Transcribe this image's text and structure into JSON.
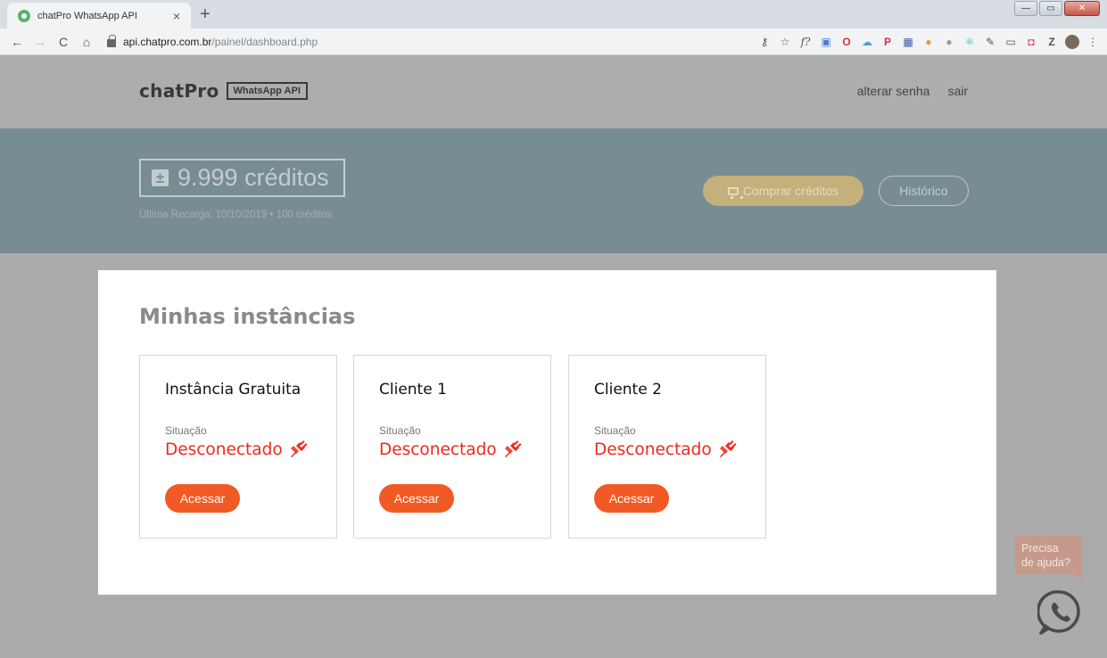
{
  "browser": {
    "tab_title": "chatPro WhatsApp API",
    "tab_close": "×",
    "new_tab": "+",
    "url_host": "api.chatpro.com.br",
    "url_path": "/painel/dashboard.php",
    "window_controls": [
      "—",
      "▭",
      "✕"
    ]
  },
  "header": {
    "logo": "chatPro",
    "logo_badge": "WhatsApp API",
    "links": {
      "change_password": "alterar senha",
      "logout": "sair"
    }
  },
  "credits": {
    "amount_label": "9.999 créditos",
    "last_recharge": "Última Recarga: 10/10/2019 • 100 créditos",
    "buy_label": "Comprar créditos",
    "history_label": "Histórico"
  },
  "instances": {
    "title": "Minhas instâncias",
    "status_label": "Situação",
    "access_label": "Acessar",
    "status_color": "#ee2a1c",
    "button_color": "#f15a24",
    "items": [
      {
        "name": "Instância Gratuita",
        "status": "Desconectado"
      },
      {
        "name": "Cliente 1",
        "status": "Desconectado"
      },
      {
        "name": "Cliente 2",
        "status": "Desconectado"
      }
    ]
  },
  "help": {
    "line1": "Precisa",
    "line2": "de ajuda?"
  }
}
